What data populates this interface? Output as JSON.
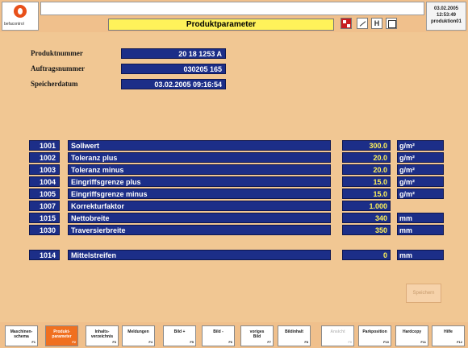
{
  "header": {
    "logo_text": "befacontrol",
    "title": "Produktparameter",
    "date": "03.02.2005",
    "time": "12:53:49",
    "user": "produktion01"
  },
  "info": [
    {
      "label": "Produktnummer",
      "value": "20 18 1253 A"
    },
    {
      "label": "Auftragsnummer",
      "value": "030205 165"
    },
    {
      "label": "Speicherdatum",
      "value": "03.02.2005 09:16:54"
    }
  ],
  "params": [
    {
      "num": "1001",
      "name": "Sollwert",
      "value": "300.0",
      "unit": "g/m²"
    },
    {
      "num": "1002",
      "name": "Toleranz plus",
      "value": "20.0",
      "unit": "g/m²"
    },
    {
      "num": "1003",
      "name": "Toleranz minus",
      "value": "20.0",
      "unit": "g/m²"
    },
    {
      "num": "1004",
      "name": "Eingriffsgrenze plus",
      "value": "15.0",
      "unit": "g/m²"
    },
    {
      "num": "1005",
      "name": "Eingriffsgrenze minus",
      "value": "15.0",
      "unit": "g/m²"
    },
    {
      "num": "1007",
      "name": "Korrekturfaktor",
      "value": "1.000",
      "unit": ""
    },
    {
      "num": "1015",
      "name": "Nettobreite",
      "value": "340",
      "unit": "mm"
    },
    {
      "num": "1030",
      "name": "Traversierbreite",
      "value": "350",
      "unit": "mm"
    },
    {
      "num": "1014",
      "name": "Mittelstreifen",
      "value": "0",
      "unit": "mm"
    }
  ],
  "save_label": "Speichern",
  "fkeys": [
    {
      "l1": "Maschinen-",
      "l2": "schema",
      "f": "F1"
    },
    {
      "l1": "Produkt-",
      "l2": "parameter",
      "f": "F2"
    },
    {
      "l1": "Inhalts-",
      "l2": "verzeichnis",
      "f": "F3"
    },
    {
      "l1": "Meldungen",
      "l2": "",
      "f": "F4"
    },
    {
      "l1": "Bild +",
      "l2": "",
      "f": "F5"
    },
    {
      "l1": "Bild -",
      "l2": "",
      "f": "F6"
    },
    {
      "l1": "voriges",
      "l2": "Bild",
      "f": "F7"
    },
    {
      "l1": "Bildinhalt",
      "l2": "",
      "f": "F8"
    },
    {
      "l1": "Ansicht",
      "l2": "",
      "f": "F9"
    },
    {
      "l1": "Parkposition",
      "l2": "",
      "f": "F10"
    },
    {
      "l1": "Hardcopy",
      "l2": "",
      "f": "F11"
    },
    {
      "l1": "Hilfe",
      "l2": "",
      "f": "F12"
    }
  ],
  "colors": {
    "field_bg": "#1c2e88",
    "value_text": "#fff25a",
    "panel_bg": "#f1c793",
    "active_key": "#f07020"
  }
}
